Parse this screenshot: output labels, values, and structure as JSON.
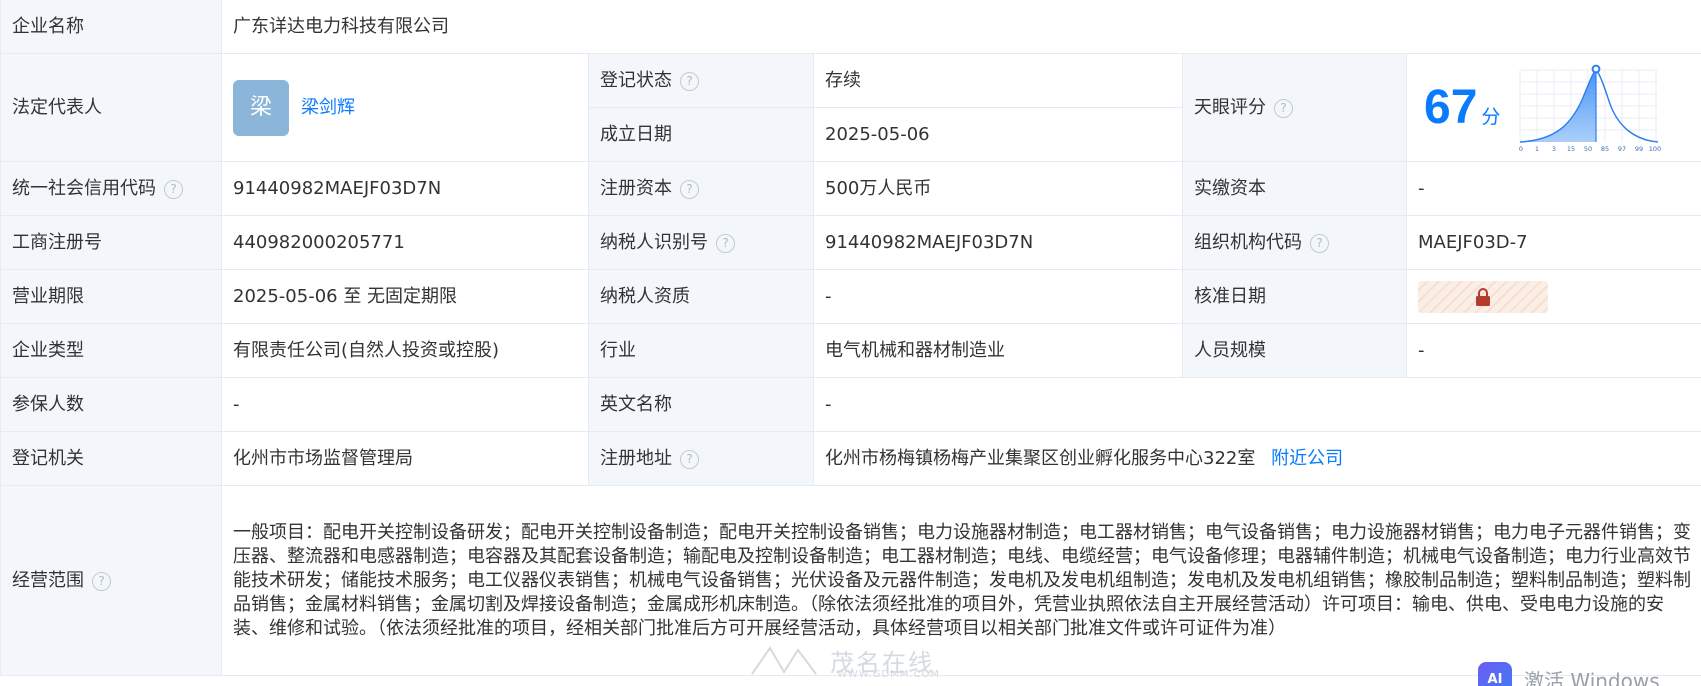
{
  "company_name": {
    "label": "企业名称",
    "value": "广东详达电力科技有限公司"
  },
  "legal_rep": {
    "label": "法定代表人",
    "avatar_char": "梁",
    "name": "梁剑辉"
  },
  "reg_status": {
    "label": "登记状态",
    "value": "存续"
  },
  "found_date": {
    "label": "成立日期",
    "value": "2025-05-06"
  },
  "tianyan_score": {
    "label": "天眼评分",
    "score": "67",
    "unit": "分",
    "chart_ticks": [
      "0",
      "1",
      "3",
      "15",
      "50",
      "85",
      "97",
      "99",
      "100"
    ],
    "colors": {
      "accent": "#0a7bff",
      "fill": "#3d8ff5"
    }
  },
  "credit_code": {
    "label": "统一社会信用代码",
    "value": "91440982MAEJF03D7N"
  },
  "reg_capital": {
    "label": "注册资本",
    "value": "500万人民币"
  },
  "paid_capital": {
    "label": "实缴资本",
    "value": "-"
  },
  "biz_reg_no": {
    "label": "工商注册号",
    "value": "440982000205771"
  },
  "taxpayer_id": {
    "label": "纳税人识别号",
    "value": "91440982MAEJF03D7N"
  },
  "org_code": {
    "label": "组织机构代码",
    "value": "MAEJF03D-7"
  },
  "biz_term": {
    "label": "营业期限",
    "value": "2025-05-06 至 无固定期限"
  },
  "taxpayer_qual": {
    "label": "纳税人资质",
    "value": "-"
  },
  "approve_date": {
    "label": "核准日期",
    "icon": "lock-icon"
  },
  "company_type": {
    "label": "企业类型",
    "value": "有限责任公司(自然人投资或控股)"
  },
  "industry": {
    "label": "行业",
    "value": "电气机械和器材制造业"
  },
  "staff_size": {
    "label": "人员规模",
    "value": "-"
  },
  "insured_count": {
    "label": "参保人数",
    "value": "-"
  },
  "english_name": {
    "label": "英文名称",
    "value": "-"
  },
  "reg_authority": {
    "label": "登记机关",
    "value": "化州市市场监督管理局"
  },
  "reg_address": {
    "label": "注册地址",
    "value": "化州市杨梅镇杨梅产业集聚区创业孵化服务中心322室",
    "link": "附近公司"
  },
  "biz_scope": {
    "label": "经营范围",
    "value": "一般项目：配电开关控制设备研发；配电开关控制设备制造；配电开关控制设备销售；电力设施器材制造；电工器材销售；电气设备销售；电力设施器材销售；电力电子元器件销售；变压器、整流器和电感器制造；电容器及其配套设备制造；输配电及控制设备制造；电工器材制造；电线、电缆经营；电气设备修理；电器辅件制造；机械电气设备制造；电力行业高效节能技术研发；储能技术服务；电工仪器仪表销售；机械电气设备销售；光伏设备及元器件制造；发电机及发电机组制造；发电机及发电机组销售；橡胶制品制造；塑料制品制造；塑料制品销售；金属材料销售；金属切割及焊接设备制造；金属成形机床制造。（除依法须经批准的项目外，凭营业执照依法自主开展经营活动）许可项目：输电、供电、受电电力设施的安装、维修和试验。（依法须经批准的项目，经相关部门批准后方可开展经营活动，具体经营项目以相关部门批准文件或许可证件为准）"
  },
  "help_glyph": "?",
  "watermark": {
    "text": "茂名在线",
    "sub": "WWW.GDMM.COM"
  },
  "activate": {
    "badge": "AI",
    "text": "激活 Windows"
  }
}
